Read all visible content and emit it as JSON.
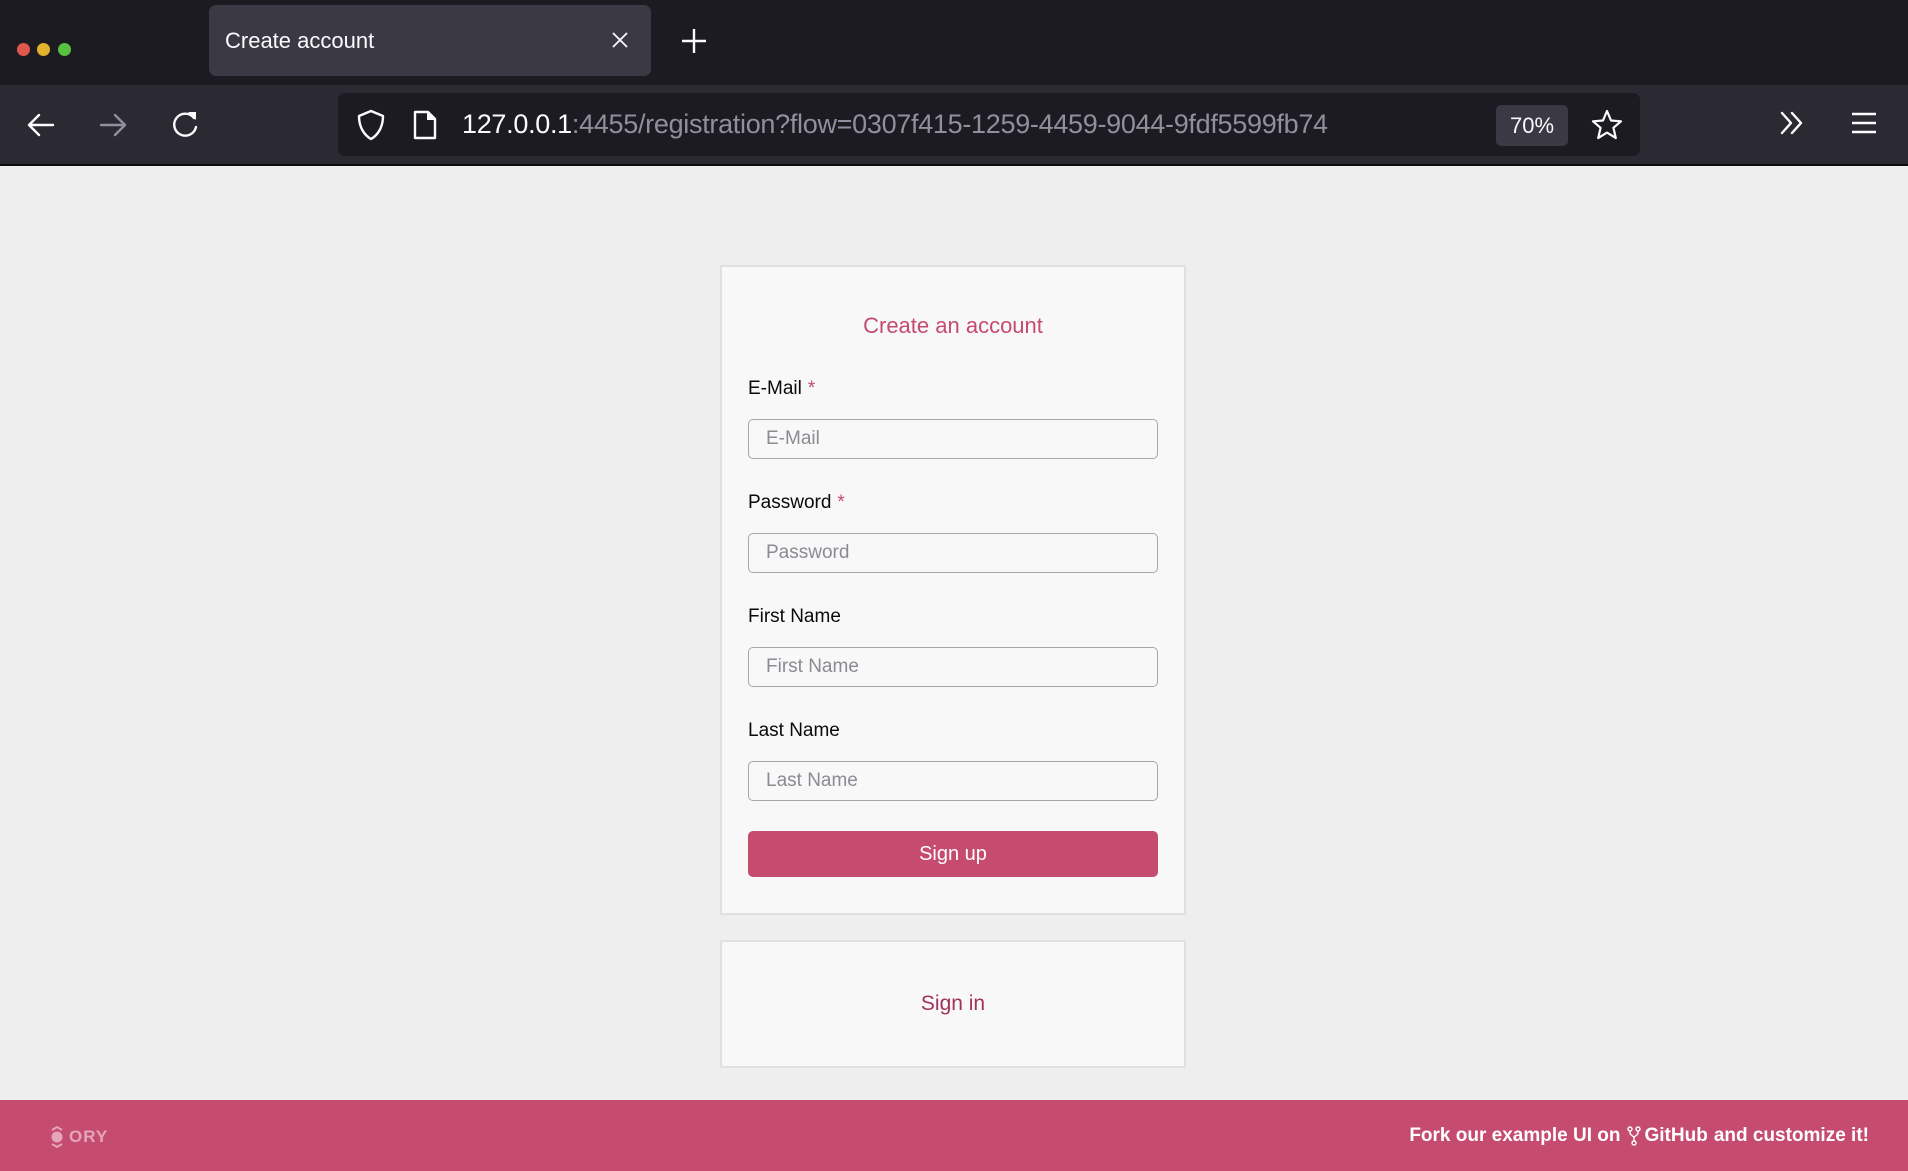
{
  "browser": {
    "tab": {
      "title": "Create account"
    },
    "url": {
      "host": "127.0.0.1",
      "rest": ":4455/registration?flow=0307f415-1259-4459-9044-9fdf5599fb74"
    },
    "zoom_level": "70%",
    "icons": {
      "back": "arrow-left-icon",
      "forward": "arrow-right-icon",
      "reload": "reload-icon",
      "shield": "shield-icon",
      "page": "page-icon",
      "bookmark": "star-icon",
      "overflow": "chevron-double-right-icon",
      "menu": "hamburger-menu-icon",
      "close_tab": "close-icon",
      "new_tab": "plus-icon"
    }
  },
  "registration": {
    "title": "Create an account",
    "fields": [
      {
        "label": "E-Mail",
        "required": true,
        "required_mark": "*",
        "placeholder": "E-Mail",
        "value": ""
      },
      {
        "label": "Password",
        "required": true,
        "required_mark": "*",
        "placeholder": "Password",
        "value": ""
      },
      {
        "label": "First Name",
        "required": false,
        "required_mark": "",
        "placeholder": "First Name",
        "value": ""
      },
      {
        "label": "Last Name",
        "required": false,
        "required_mark": "",
        "placeholder": "Last Name",
        "value": ""
      }
    ],
    "submit_label": "Sign up"
  },
  "signin": {
    "label": "Sign in"
  },
  "footer": {
    "logo_text": "ORY",
    "text_prefix": "Fork our example UI on",
    "link_label": "GitHub",
    "text_suffix": "and customize it!"
  },
  "colors": {
    "brand": "#c54b6f",
    "signin_link": "#a0325b",
    "page_bg": "#eeeeee",
    "card_bg": "#f8f8f8"
  }
}
